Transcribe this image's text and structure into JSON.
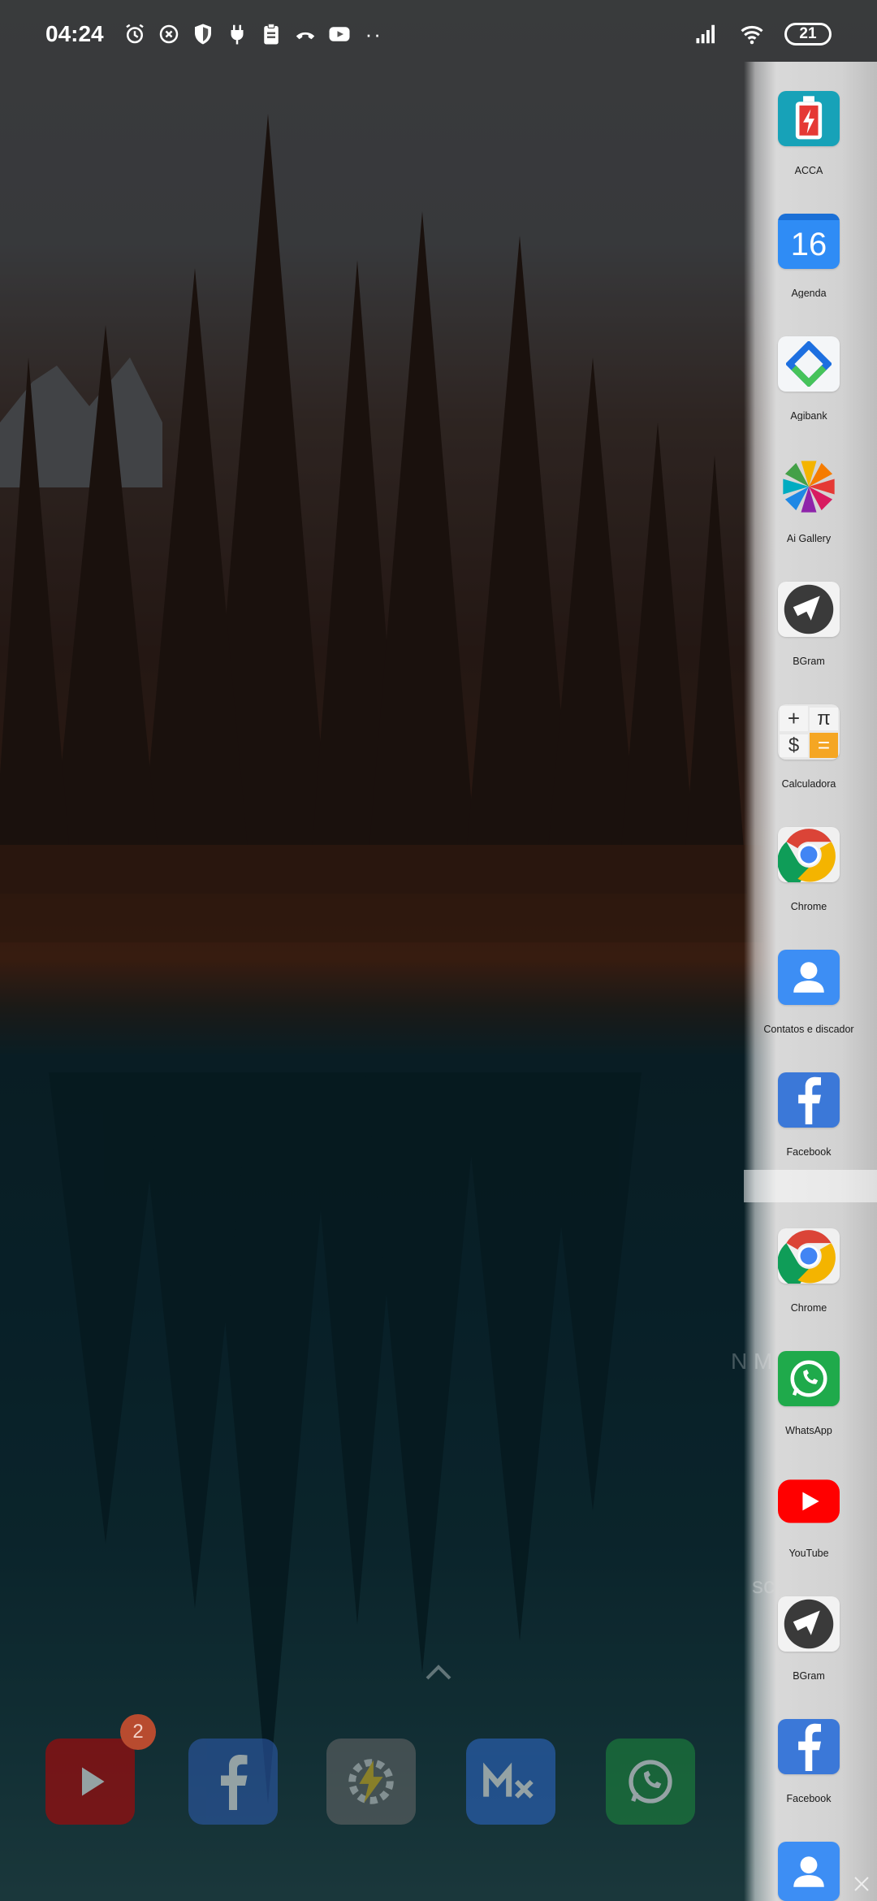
{
  "status_bar": {
    "time": "04:24",
    "left_icons": [
      "alarm-icon",
      "sync-icon",
      "shield-icon",
      "plug-icon",
      "clipboard-icon",
      "phone-icon",
      "youtube-icon"
    ],
    "overflow": "··",
    "battery_level": "21"
  },
  "sidebar": {
    "items": [
      {
        "label": "ACCA",
        "icon": "battery-charge-icon"
      },
      {
        "label": "Agenda",
        "icon": "calendar-icon",
        "icon_text": "16"
      },
      {
        "label": "Agibank",
        "icon": "agibank-icon"
      },
      {
        "label": "Ai Gallery",
        "icon": "pinwheel-icon"
      },
      {
        "label": "BGram",
        "icon": "bgram-icon"
      },
      {
        "label": "Calculadora",
        "icon": "calculator-icon"
      },
      {
        "label": "Chrome",
        "icon": "chrome-icon"
      },
      {
        "label": "Contatos e discador",
        "icon": "contacts-icon"
      },
      {
        "label": "Facebook",
        "icon": "facebook-icon"
      },
      {
        "label": "Chrome",
        "icon": "chrome-icon"
      },
      {
        "label": "WhatsApp",
        "icon": "whatsapp-icon"
      },
      {
        "label": "YouTube",
        "icon": "youtube-icon"
      },
      {
        "label": "BGram",
        "icon": "bgram-icon"
      },
      {
        "label": "Facebook",
        "icon": "facebook-icon"
      },
      {
        "label": "",
        "icon": "contacts-icon"
      }
    ]
  },
  "dock": {
    "badge_count": "2",
    "apps": [
      "youtube-icon",
      "facebook-icon",
      "tasker-icon",
      "mix-icon",
      "whatsapp-icon"
    ]
  },
  "ghost": {
    "scrcpy": "scrcpy",
    "nm": "N M"
  },
  "colors": {
    "acca": "#17a2b8",
    "agenda": "#2f8cf5",
    "facebook": "#3b78d8",
    "whatsapp": "#1faa4b",
    "youtube": "#ff0000",
    "contacts": "#3d8ef4"
  }
}
